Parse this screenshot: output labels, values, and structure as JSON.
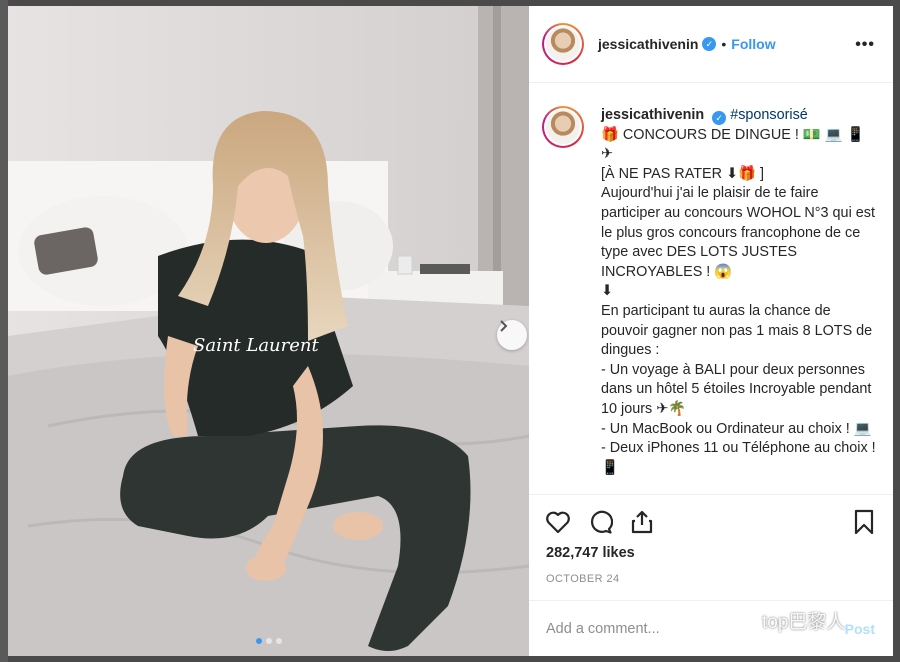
{
  "header": {
    "username": "jessicathivenin",
    "separator": "•",
    "follow_label": "Follow",
    "more_glyph": "•••"
  },
  "caption": {
    "username": "jessicathivenin",
    "hashtag": "#sponsorisé",
    "lines": [
      "🎁  CONCOURS DE DINGUE ! 💵 💻 📱",
      "✈",
      "[À NE PAS RATER ⬇🎁 ]",
      "Aujourd'hui j'ai le plaisir de te faire participer au concours WOHOL N°3 qui est le plus gros concours francophone de ce type avec DES LOTS JUSTES INCROYABLES ! 😱",
      "⬇",
      "En participant tu auras la chance de pouvoir gagner non pas 1 mais 8 LOTS de dingues :",
      "- Un voyage à BALI pour deux personnes dans un hôtel 5 étoiles Incroyable pendant 10 jours ✈🌴",
      "- Un MacBook ou Ordinateur au choix ! 💻",
      "- Deux iPhones 11 ou Téléphone au choix ! 📱"
    ]
  },
  "engagement": {
    "likes": "282,747 likes",
    "date": "OCTOBER 24"
  },
  "comment_box": {
    "placeholder": "Add a comment...",
    "post_label": "Post"
  },
  "photo": {
    "shirt_text": "Saint Laurent",
    "carousel_index": 1,
    "carousel_count": 3
  },
  "watermark": {
    "text": "top巴黎人"
  },
  "colors": {
    "accent": "#3897f0",
    "text": "#262626",
    "muted": "#8e8e8e"
  }
}
